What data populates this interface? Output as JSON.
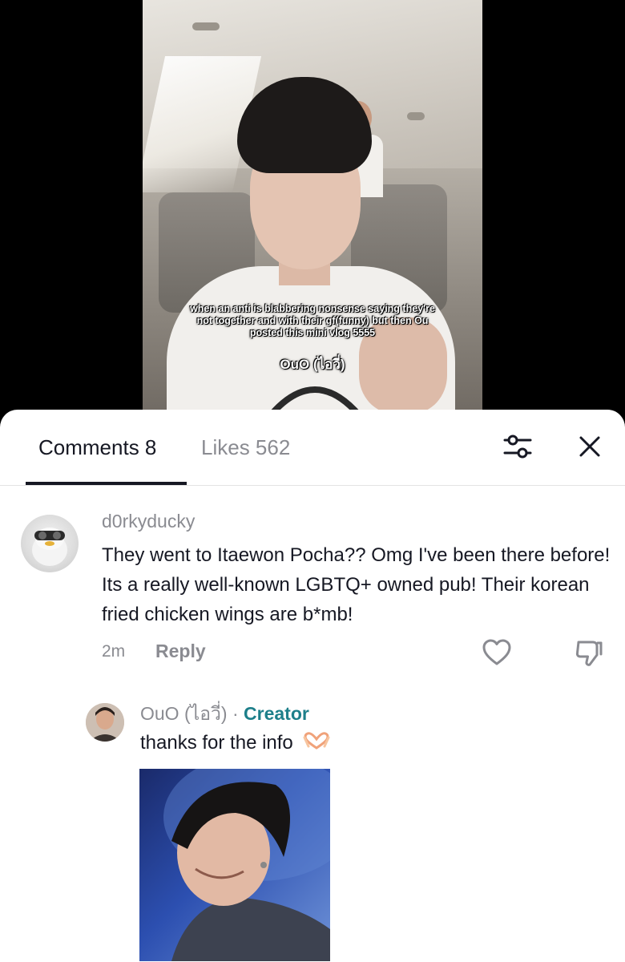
{
  "video": {
    "caption": "when an anti is blabbering nonsense saying they're not together and with their gf(funny) but then Ou posted this mini vlog 5555",
    "tag": "OuO (ไอวี่)"
  },
  "tabs": {
    "comments_label": "Comments 8",
    "likes_label": "Likes 562"
  },
  "icons": {
    "filter": "sliders-icon",
    "close": "close-icon",
    "like": "heart-outline-icon",
    "dislike": "thumbs-down-icon",
    "reply_emoji": "heart-hands-emoji"
  },
  "comment": {
    "username": "d0rkyducky",
    "text": "They went to Itaewon Pocha?? Omg I've been there before! Its a really well-known LGBTQ+ owned pub! Their korean fried chicken wings are b*mb!",
    "time": "2m",
    "reply_label": "Reply"
  },
  "reply": {
    "username": "OuO (ไอวี่)",
    "separator": " · ",
    "badge": "Creator",
    "text": "thanks for the info"
  },
  "colors": {
    "text_primary": "#161823",
    "text_secondary": "#8a8b91",
    "creator_accent": "#1d7f8a",
    "divider": "#e3e3e3"
  }
}
